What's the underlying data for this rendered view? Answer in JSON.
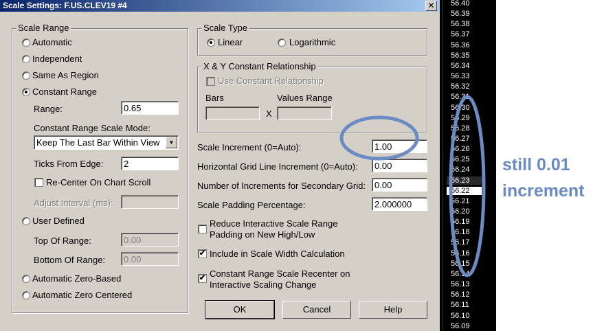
{
  "dialog": {
    "title": "Scale Settings: F.US.CLEV19  #4",
    "close_glyph": "✕",
    "scale_range": {
      "legend": "Scale Range",
      "automatic": "Automatic",
      "independent": "Independent",
      "same_as_region": "Same As Region",
      "constant_range": "Constant Range",
      "range_label": "Range:",
      "range_value": "0.65",
      "mode_label": "Constant Range Scale Mode:",
      "mode_value": "Keep The Last Bar Within View",
      "ticks_label": "Ticks From Edge:",
      "ticks_value": "2",
      "recenter_label": "Re-Center On Chart Scroll",
      "adjust_label": "Adjust Interval (ms):",
      "adjust_value": "",
      "user_defined": "User Defined",
      "top_label": "Top Of Range:",
      "top_value": "0.00",
      "bottom_label": "Bottom Of Range:",
      "bottom_value": "0.00",
      "auto_zero_based": "Automatic Zero-Based",
      "auto_zero_centered": "Automatic Zero Centered"
    },
    "scale_type": {
      "legend": "Scale Type",
      "linear": "Linear",
      "logarithmic": "Logarithmic"
    },
    "xy": {
      "legend": "X & Y Constant Relationship",
      "use_label": "Use Constant Relationship",
      "bars_label": "Bars",
      "values_label": "Values Range",
      "x_label": "X"
    },
    "settings": {
      "scale_increment_label": "Scale Increment (0=Auto):",
      "scale_increment_value": "1.00",
      "hgrid_label": "Horizontal Grid Line Increment (0=Auto):",
      "hgrid_value": "0.00",
      "secondary_label": "Number of Increments for Secondary Grid:",
      "secondary_value": "0.00",
      "padding_label": "Scale Padding Percentage:",
      "padding_value": "2.000000",
      "reduce_label_1": "Reduce Interactive Scale Range",
      "reduce_label_2": "Padding on New High/Low",
      "include_label": "Include in Scale Width Calculation",
      "recenter_label_1": "Constant Range Scale Recenter on",
      "recenter_label_2": "Interactive Scaling Change",
      "check_glyph": "✔"
    },
    "buttons": {
      "ok": "OK",
      "cancel": "Cancel",
      "help": "Help"
    }
  },
  "price_scale": {
    "ticks": [
      "56.40",
      "56.39",
      "56.38",
      "56.37",
      "56.36",
      "56.35",
      "56.34",
      "56.33",
      "56.32",
      "56.31",
      "56.30",
      "56.29",
      "56.28",
      "56.27",
      "56.26",
      "56.25",
      "56.24",
      "56.23",
      "56.22",
      "56.21",
      "56.20",
      "56.19",
      "56.18",
      "56.17",
      "56.16",
      "56.15",
      "56.14",
      "56.13",
      "56.12",
      "56.11",
      "56.10",
      "56.09"
    ],
    "highlighted": "56.22",
    "current": "56.23"
  },
  "annotation": {
    "line1": "still 0.01",
    "line2": "increment",
    "color": "#6b8cc2"
  }
}
